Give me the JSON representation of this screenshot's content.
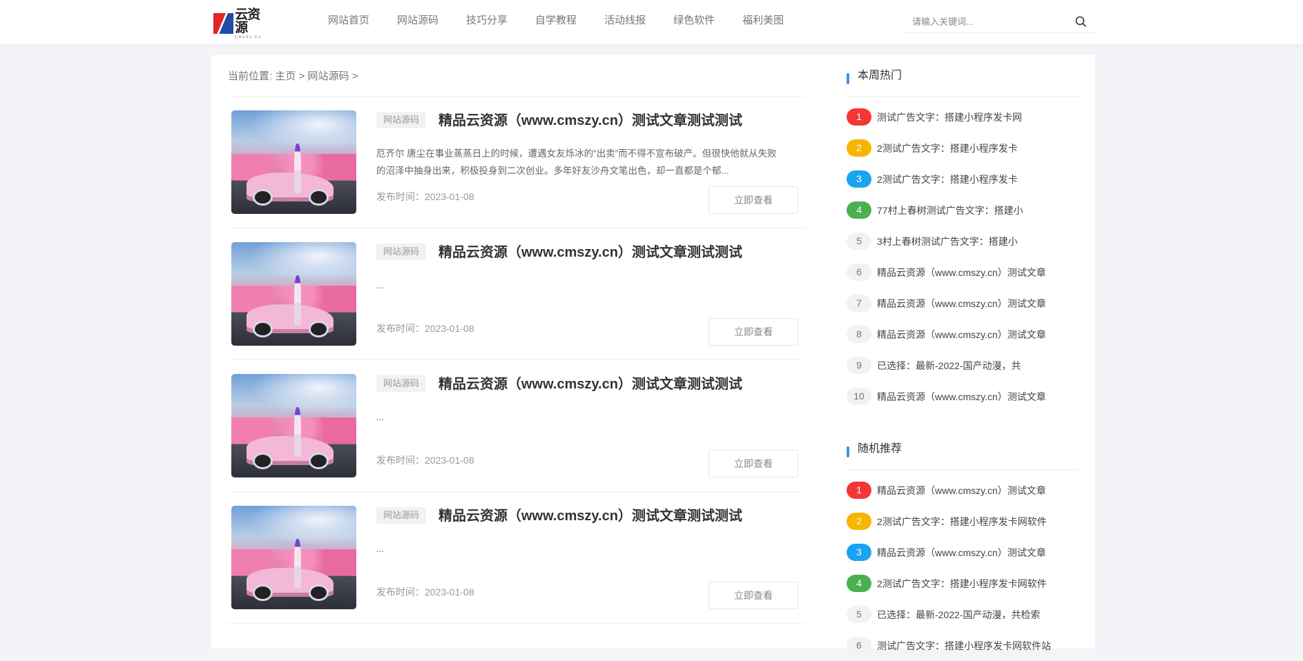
{
  "logo": {
    "name_cn": "云资源",
    "name_en": "CmsZy.Cn",
    "colors": [
      "#e3242b",
      "#1f4aa8"
    ]
  },
  "nav": [
    "网站首页",
    "网站源码",
    "技巧分享",
    "自学教程",
    "活动线报",
    "绿色软件",
    "福利美图"
  ],
  "search": {
    "placeholder": "请输入关键词..."
  },
  "breadcrumb": {
    "prefix": "当前位置:",
    "home": "主页",
    "sep1": " > ",
    "category": "网站源码",
    "sep2": " >"
  },
  "posts": [
    {
      "tag": "网站源码",
      "title": "精品云资源（www.cmszy.cn）测试文章测试测试",
      "excerpt": "厄齐尔 唐尘在事业蒸蒸日上的时候，遭遇女友烁冰的“出卖”而不得不宣布破产。但很快他就从失败的沼泽中抽身出来，积极投身到二次创业。多年好友沙舟文笔出色，却一直都是个郁...",
      "date": "发布时间：2023-01-08",
      "button": "立即查看"
    },
    {
      "tag": "网站源码",
      "title": "精品云资源（www.cmszy.cn）测试文章测试测试",
      "excerpt": "...",
      "date": "发布时间：2023-01-08",
      "button": "立即查看"
    },
    {
      "tag": "网站源码",
      "title": "精品云资源（www.cmszy.cn）测试文章测试测试",
      "excerpt": "...",
      "date": "发布时间：2023-01-08",
      "button": "立即查看"
    },
    {
      "tag": "网站源码",
      "title": "精品云资源（www.cmszy.cn）测试文章测试测试",
      "excerpt": "...",
      "date": "发布时间：2023-01-08",
      "button": "立即查看"
    }
  ],
  "hot": {
    "title": "本周热门",
    "items": [
      {
        "num": "1",
        "text": "测试广告文字：搭建小程序发卡网"
      },
      {
        "num": "2",
        "text": "2测试广告文字：搭建小程序发卡"
      },
      {
        "num": "3",
        "text": "2测试广告文字：搭建小程序发卡"
      },
      {
        "num": "4",
        "text": "77村上春树测试广告文字：搭建小"
      },
      {
        "num": "5",
        "text": "3村上春树测试广告文字：搭建小"
      },
      {
        "num": "6",
        "text": "精品云资源（www.cmszy.cn）测试文章"
      },
      {
        "num": "7",
        "text": "精品云资源（www.cmszy.cn）测试文章"
      },
      {
        "num": "8",
        "text": "精品云资源（www.cmszy.cn）测试文章"
      },
      {
        "num": "9",
        "text": "已选择：最新-2022-国产动漫，共"
      },
      {
        "num": "10",
        "text": "精品云资源（www.cmszy.cn）测试文章"
      }
    ]
  },
  "random": {
    "title": "随机推荐",
    "items": [
      {
        "num": "1",
        "text": "精品云资源（www.cmszy.cn）测试文章"
      },
      {
        "num": "2",
        "text": "2测试广告文字：搭建小程序发卡网软件"
      },
      {
        "num": "3",
        "text": "精品云资源（www.cmszy.cn）测试文章"
      },
      {
        "num": "4",
        "text": "2测试广告文字：搭建小程序发卡网软件"
      },
      {
        "num": "5",
        "text": "已选择：最新-2022-国产动漫，共检索"
      },
      {
        "num": "6",
        "text": "测试广告文字：搭建小程序发卡网软件站"
      }
    ]
  },
  "rank_colors": {
    "1": "#f53636",
    "2": "#f7b500",
    "3": "#1aa3f0",
    "4": "#4caf50"
  },
  "accent": "#4a90e2"
}
